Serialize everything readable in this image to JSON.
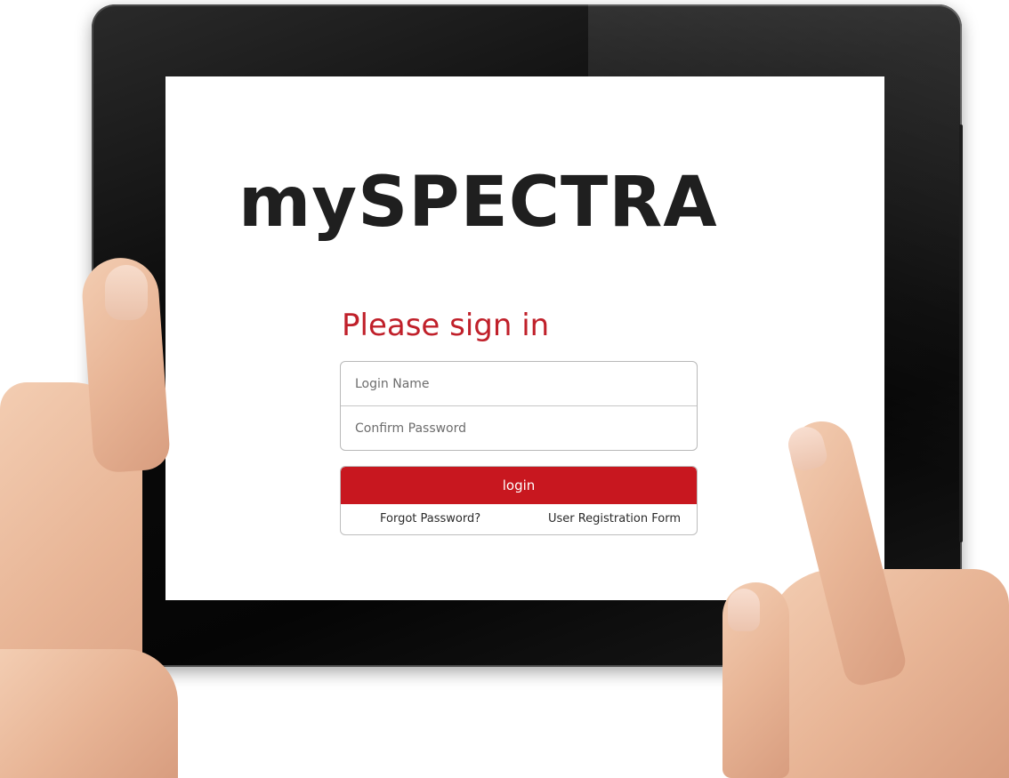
{
  "app": {
    "brand": "mySPECTRA"
  },
  "signin": {
    "title": "Please sign in",
    "login_name_placeholder": "Login Name",
    "password_placeholder": "Confirm Password",
    "login_label": "login",
    "forgot_password": "Forgot Password?",
    "registration": "User Registration Form"
  },
  "colors": {
    "accent": "#c8171f",
    "brand_text": "#1f1f1f",
    "tablet_bezel": "#0b0b0b"
  }
}
